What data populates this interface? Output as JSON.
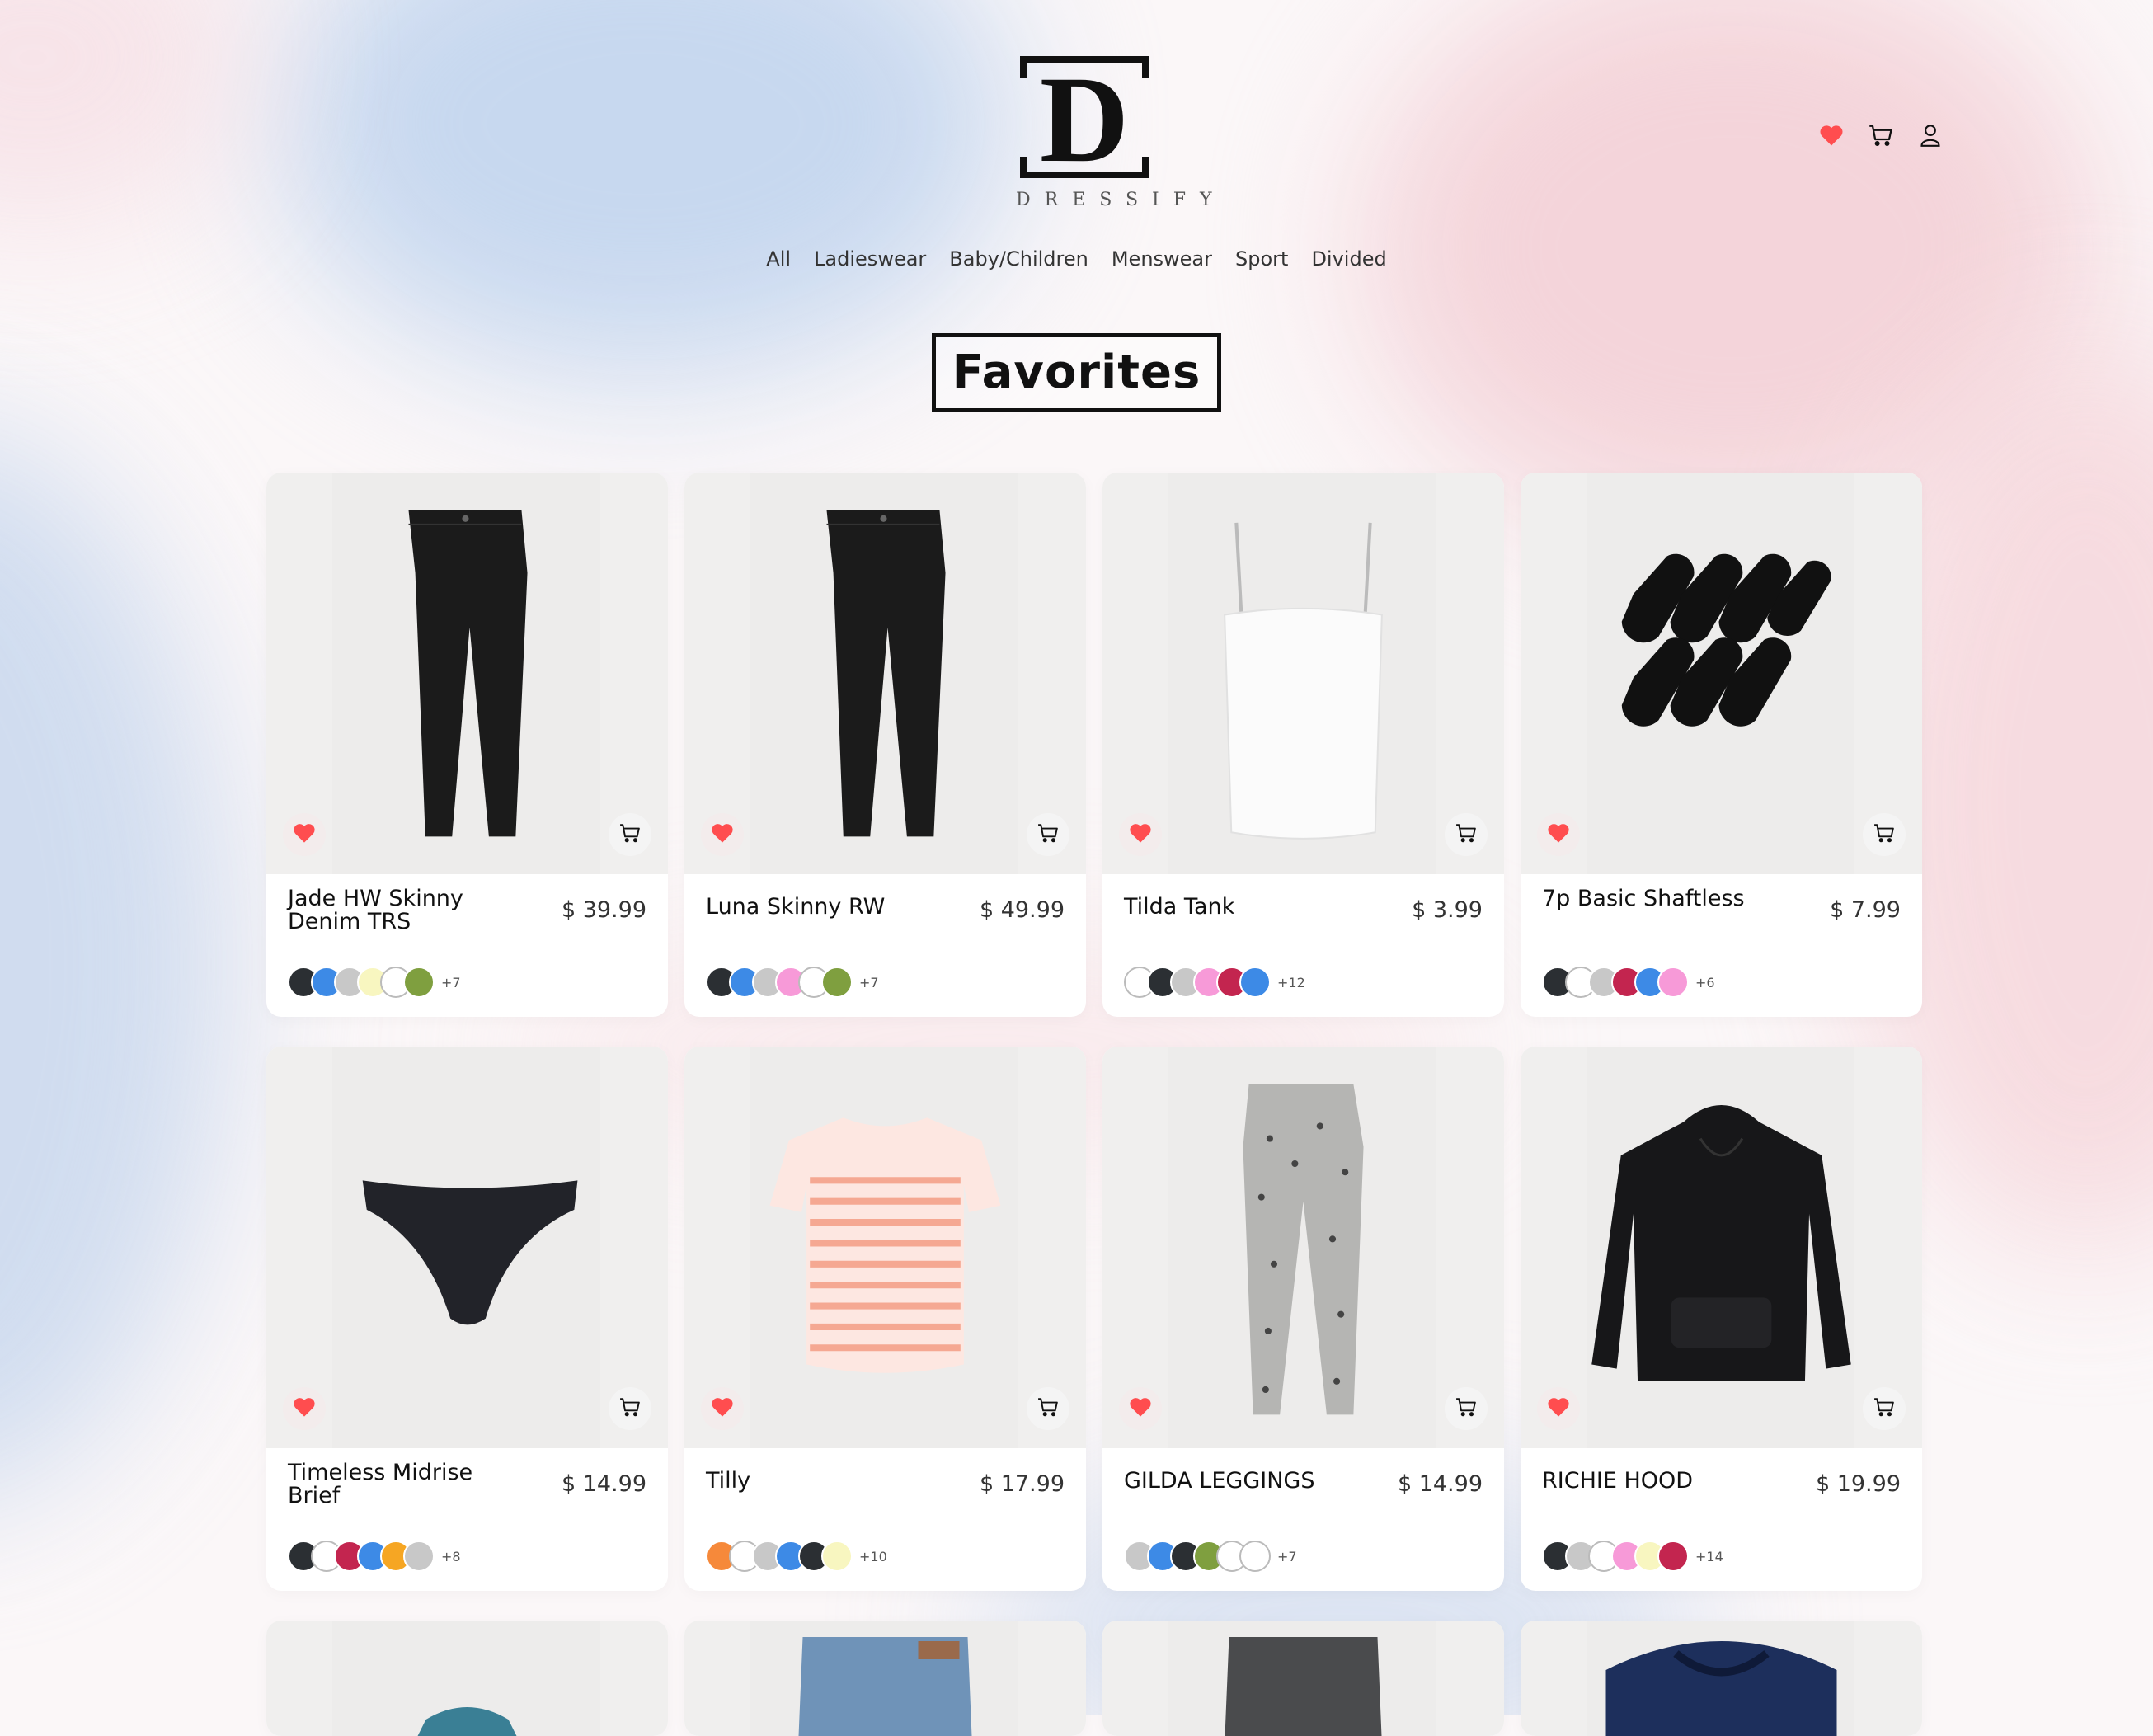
{
  "brand": {
    "name": "DRESSIFY",
    "letter": "D"
  },
  "nav": [
    "All",
    "Ladieswear",
    "Baby/Children",
    "Menswear",
    "Sport",
    "Divided"
  ],
  "header_icons": [
    "heart-icon",
    "cart-icon",
    "user-icon"
  ],
  "page_title": "Favorites",
  "colors": {
    "heart": "#ff4d4f",
    "text": "#111111"
  },
  "products": [
    {
      "name": "Jade HW Skinny Denim TRS",
      "price": "$ 39.99",
      "more": "+7",
      "type": "jeans",
      "swatches": [
        "#2b2f33",
        "#3d8ae6",
        "#c8c8c8",
        "#f8f6c0",
        "#ffffff",
        "#7f9f3f"
      ]
    },
    {
      "name": "Luna Skinny RW",
      "price": "$ 49.99",
      "more": "+7",
      "type": "jeans",
      "swatches": [
        "#2b2f33",
        "#3d8ae6",
        "#c8c8c8",
        "#f79ad8",
        "#ffffff",
        "#7f9f3f"
      ]
    },
    {
      "name": "Tilda Tank",
      "price": "$ 3.99",
      "more": "+12",
      "type": "tank",
      "swatches": [
        "#ffffff",
        "#2b2f33",
        "#c8c8c8",
        "#f79ad8",
        "#c3254f",
        "#3d8ae6"
      ]
    },
    {
      "name": "7p Basic Shaftless",
      "price": "$ 7.99",
      "more": "+6",
      "type": "socks",
      "swatches": [
        "#2b2f33",
        "#ffffff",
        "#c8c8c8",
        "#c3254f",
        "#3d8ae6",
        "#f79ad8"
      ]
    },
    {
      "name": "Timeless Midrise Brief",
      "price": "$ 14.99",
      "more": "+8",
      "type": "brief",
      "swatches": [
        "#2b2f33",
        "#ffffff",
        "#c3254f",
        "#3d8ae6",
        "#f6a623",
        "#c8c8c8"
      ]
    },
    {
      "name": "Tilly",
      "price": "$ 17.99",
      "more": "+10",
      "type": "tee",
      "swatches": [
        "#f6893a",
        "#ffffff",
        "#c8c8c8",
        "#3d8ae6",
        "#2b2f33",
        "#f8f6c0"
      ]
    },
    {
      "name": "GILDA LEGGINGS",
      "price": "$ 14.99",
      "more": "+7",
      "type": "leggings",
      "swatches": [
        "#c8c8c8",
        "#3d8ae6",
        "#2b2f33",
        "#7f9f3f",
        "#ffffff",
        "#ffffff"
      ]
    },
    {
      "name": "RICHIE HOOD",
      "price": "$ 19.99",
      "more": "+14",
      "type": "hoodie",
      "swatches": [
        "#2b2f33",
        "#c8c8c8",
        "#ffffff",
        "#f79ad8",
        "#f8f6c0",
        "#c3254f"
      ]
    }
  ],
  "partial_row_icons": [
    "top-icon",
    "denim-shorts-icon",
    "jeans-icon",
    "sweater-icon"
  ]
}
